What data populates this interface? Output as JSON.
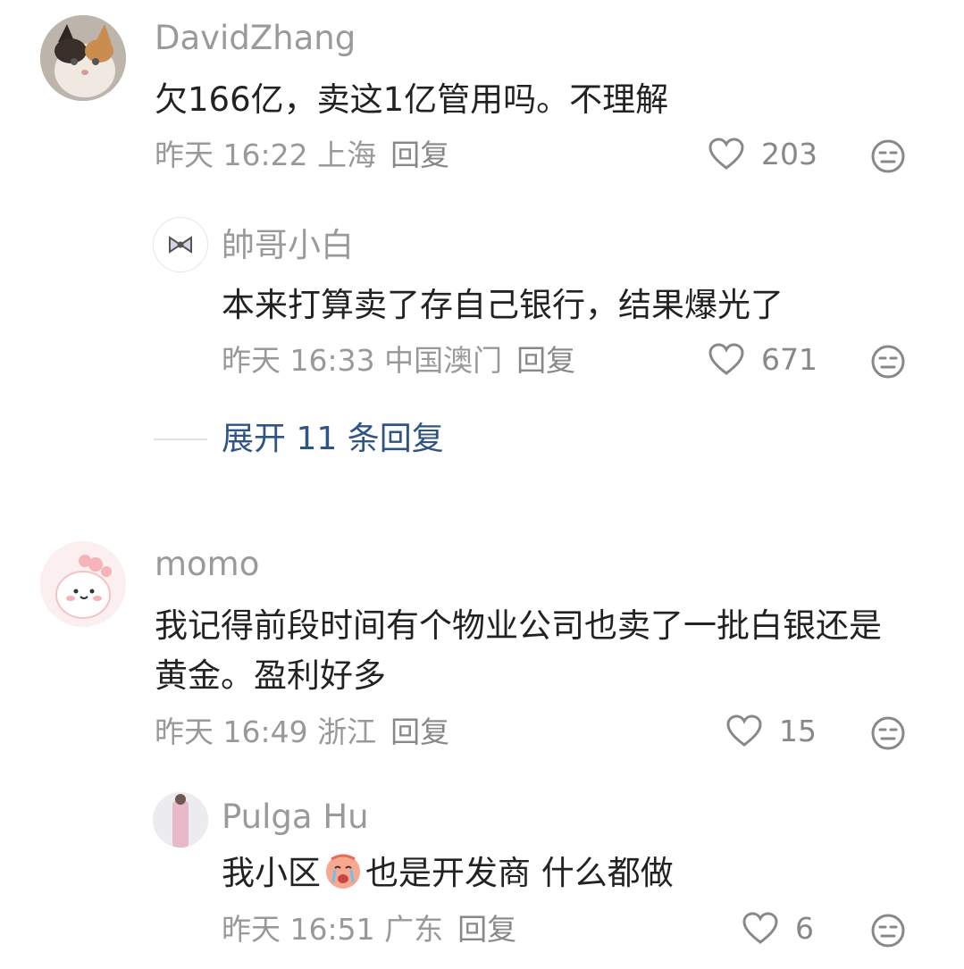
{
  "comments": [
    {
      "username": "DavidZhang",
      "content": "欠166亿，卖这1亿管用吗。不理解",
      "meta": "昨天 16:22 上海",
      "reply_label": "回复",
      "likes": "203",
      "avatar": "cat-photo"
    },
    {
      "username": "帥哥小白",
      "content": "本来打算卖了存自己银行，结果爆光了",
      "meta": "昨天 16:33 中国澳门",
      "reply_label": "回复",
      "likes": "671",
      "avatar": "bow-icon"
    },
    {
      "username": "momo",
      "content": "我记得前段时间有个物业公司也卖了一批白银还是黄金。盈利好多",
      "meta": "昨天 16:49 浙江",
      "reply_label": "回复",
      "likes": "15",
      "avatar": "pink-cartoon"
    },
    {
      "username": "Pulga Hu",
      "content_before": "我小区",
      "content_after": "也是开发商 什么都做",
      "meta": "昨天 16:51 广东",
      "reply_label": "回复",
      "likes": "6",
      "avatar": "person-photo"
    }
  ],
  "expand_replies": "展开 11 条回复",
  "colors": {
    "text": "#222222",
    "muted": "#999999",
    "link": "#2f5587",
    "divider": "#e2e2e2"
  }
}
